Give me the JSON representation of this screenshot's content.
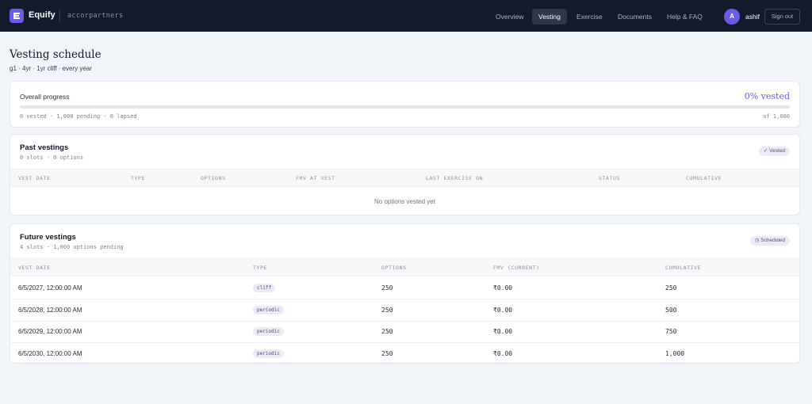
{
  "app": {
    "brand": "Equify",
    "org": "accorpartners",
    "nav": [
      {
        "label": "Overview",
        "active": false
      },
      {
        "label": "Vesting",
        "active": true
      },
      {
        "label": "Exercise",
        "active": false
      },
      {
        "label": "Documents",
        "active": false
      },
      {
        "label": "Help & FAQ",
        "active": false
      }
    ],
    "user": {
      "initial": "A",
      "name": "ashif"
    },
    "signout_label": "Sign out"
  },
  "colors": {
    "accent": "#6d5ce8",
    "nav_bg": "#121a2b",
    "page_bg": "#f1f4f8"
  },
  "page": {
    "title": "Vesting schedule",
    "subtitle": "g1 · 4yr · 1yr cliff · every year"
  },
  "progress": {
    "label": "Overall progress",
    "percent_label": "0% vested",
    "fraction": 0,
    "stats": "0 vested · 1,000 pending · 0 lapsed",
    "total": "of 1,000"
  },
  "past": {
    "title": "Past vestings",
    "subtitle": "0 slots · 0 options",
    "badge": "✓ Vested",
    "columns": [
      "VEST DATE",
      "TYPE",
      "OPTIONS",
      "FMV AT VEST",
      "LAST EXERCISE ON",
      "STATUS",
      "CUMULATIVE"
    ],
    "empty": "No options vested yet"
  },
  "future": {
    "title": "Future vestings",
    "subtitle": "4 slots · 1,000 options pending",
    "badge": "◷ Scheduled",
    "columns": [
      "VEST DATE",
      "TYPE",
      "OPTIONS",
      "FMV (CURRENT)",
      "CUMULATIVE"
    ],
    "rows": [
      {
        "date": "6/5/2027, 12:00:00 AM",
        "type": "cliff",
        "options": "250",
        "fmv": "₹0.00",
        "cumulative": "250"
      },
      {
        "date": "6/5/2028, 12:00:00 AM",
        "type": "periodic",
        "options": "250",
        "fmv": "₹0.00",
        "cumulative": "500"
      },
      {
        "date": "6/5/2029, 12:00:00 AM",
        "type": "periodic",
        "options": "250",
        "fmv": "₹0.00",
        "cumulative": "750"
      },
      {
        "date": "6/5/2030, 12:00:00 AM",
        "type": "periodic",
        "options": "250",
        "fmv": "₹0.00",
        "cumulative": "1,000"
      }
    ]
  }
}
